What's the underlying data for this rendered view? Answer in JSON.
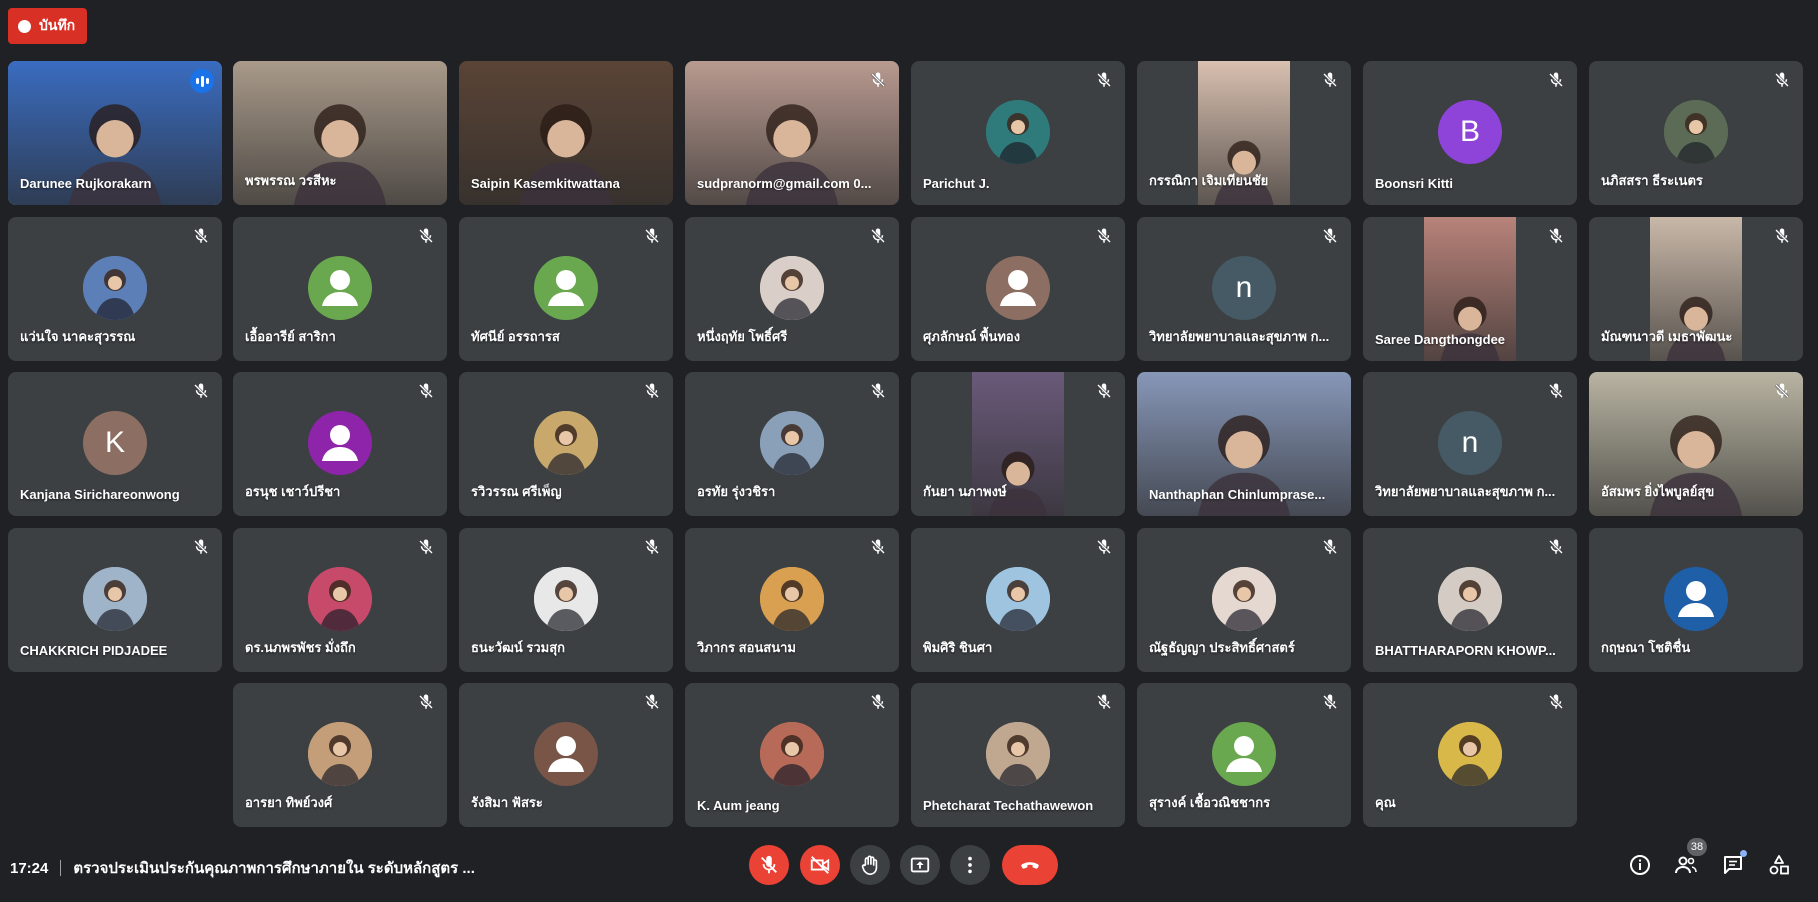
{
  "recording": {
    "label": "บันทึก",
    "color": "#d93025"
  },
  "meeting": {
    "time": "17:24",
    "title": "ตรวจประเมินประกันคุณภาพการศึกษาภายใน ระดับหลักสูตร ..."
  },
  "participants_count": "38",
  "participants": [
    {
      "name": "Darunee Rujkorakarn",
      "kind": "video",
      "bg": "#3a6cc0",
      "speaking": true
    },
    {
      "name": "พรพรรณ วรสีหะ",
      "kind": "video",
      "bg": "#a99a8a"
    },
    {
      "name": "Saipin Kasemkitwattana",
      "kind": "video",
      "bg": "#5a4436"
    },
    {
      "name": "sudpranorm@gmail.com 0...",
      "kind": "video",
      "bg": "#b89a90",
      "muted": true
    },
    {
      "name": "Parichut J.",
      "kind": "photo",
      "bg": "#2f7a7a",
      "muted": true
    },
    {
      "name": "กรรณิกา เจิมเทียนชัย",
      "kind": "video-narrow",
      "bg": "#d9c0b0",
      "muted": true
    },
    {
      "name": "Boonsri Kitti",
      "kind": "letter",
      "letter": "B",
      "bg": "#8e44d8",
      "muted": true
    },
    {
      "name": "นภิสสรา ธีระเนตร",
      "kind": "photo",
      "bg": "#5b6b55",
      "muted": true
    },
    {
      "name": "แว่นใจ นาคะสุวรรณ",
      "kind": "photo",
      "bg": "#5d7fb8",
      "muted": true
    },
    {
      "name": "เอื้ออารีย์ สาริกา",
      "kind": "default",
      "bg": "#6aa84f",
      "muted": true
    },
    {
      "name": "ทัศนีย์ อรรถารส",
      "kind": "default",
      "bg": "#6aa84f",
      "muted": true
    },
    {
      "name": "หนึ่งฤทัย โพธิ์ศรี",
      "kind": "photo",
      "bg": "#d9cfc8",
      "muted": true
    },
    {
      "name": "ศุภลักษณ์ พื้นทอง",
      "kind": "default",
      "bg": "#8d6e63",
      "muted": true
    },
    {
      "name": "วิทยาลัยพยาบาลและสุขภาพ ก...",
      "kind": "letter",
      "letter": "n",
      "bg": "#455a64",
      "muted": true
    },
    {
      "name": "Saree Dangthongdee",
      "kind": "video-narrow",
      "bg": "#b8837a",
      "muted": true
    },
    {
      "name": "มัณฑนาวดี เมธาพัฒนะ",
      "kind": "video-narrow",
      "bg": "#c9b8a8",
      "muted": true
    },
    {
      "name": "Kanjana Sirichareonwong",
      "kind": "letter",
      "letter": "K",
      "bg": "#8d6e63",
      "muted": true
    },
    {
      "name": "อรนุช เชาว์ปรีชา",
      "kind": "default",
      "bg": "#8e24aa",
      "muted": true
    },
    {
      "name": "รวิวรรณ ศรีเพ็ญ",
      "kind": "photo",
      "bg": "#c8a96b",
      "muted": true
    },
    {
      "name": "อรทัย รุ่งวชิรา",
      "kind": "photo",
      "bg": "#8aa0b8",
      "muted": true
    },
    {
      "name": "กันยา นภาพงษ์",
      "kind": "video-narrow",
      "bg": "#6a5a7a",
      "muted": true
    },
    {
      "name": "Nanthaphan Chinlumprase...",
      "kind": "video",
      "bg": "#8797b8"
    },
    {
      "name": "วิทยาลัยพยาบาลและสุขภาพ ก...",
      "kind": "letter",
      "letter": "n",
      "bg": "#455a64",
      "muted": true
    },
    {
      "name": "อัสมพร ยิ่งไพบูลย์สุข",
      "kind": "video",
      "bg": "#b9b4a2",
      "muted": true
    },
    {
      "name": "CHAKKRICH PIDJADEE",
      "kind": "photo",
      "bg": "#9fb4c8",
      "muted": true
    },
    {
      "name": "ดร.นภพรพัชร มั่งถึก",
      "kind": "photo",
      "bg": "#c84a6a",
      "muted": true
    },
    {
      "name": "ธนะวัฒน์ รวมสุก",
      "kind": "photo",
      "bg": "#e8e8e8",
      "muted": true
    },
    {
      "name": "วิภากร สอนสนาม",
      "kind": "photo",
      "bg": "#d8a050",
      "muted": true
    },
    {
      "name": "พิมศิริ ชินศา",
      "kind": "photo",
      "bg": "#9ec4e0",
      "muted": true
    },
    {
      "name": "ณัฐธัญญา ประสิทธิ์ศาสตร์",
      "kind": "photo",
      "bg": "#e4d8d0",
      "muted": true
    },
    {
      "name": "BHATTHARAPORN KHOWP...",
      "kind": "photo",
      "bg": "#d4ccc4",
      "muted": true
    },
    {
      "name": "กฤษณา โชติชื่น",
      "kind": "default",
      "bg": "#1e5fa8",
      "muted": false
    },
    {
      "name": "อารยา ทิพย์วงศ์",
      "kind": "photo",
      "bg": "#c49e78",
      "muted": true
    },
    {
      "name": "รังสิมา ฟัสระ",
      "kind": "default",
      "bg": "#795548",
      "muted": true
    },
    {
      "name": "K. Aum jeang",
      "kind": "photo",
      "bg": "#b86a58",
      "muted": true
    },
    {
      "name": "Phetcharat Techathawewon",
      "kind": "photo",
      "bg": "#c0a890",
      "muted": true
    },
    {
      "name": "สุรางค์ เชื้อวณิชชากร",
      "kind": "default",
      "bg": "#6aa84f",
      "muted": true
    },
    {
      "name": "คุณ",
      "kind": "photo",
      "bg": "#d8b848",
      "muted": true
    }
  ],
  "controls": [
    "mic-off",
    "camera-off",
    "raise-hand",
    "present",
    "more",
    "hang-up"
  ],
  "right_icons": [
    "info",
    "people",
    "chat",
    "activities"
  ]
}
